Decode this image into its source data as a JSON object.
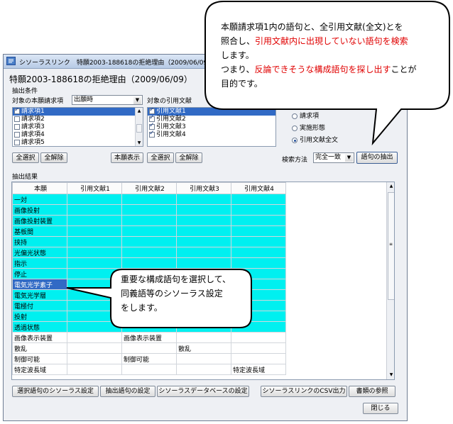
{
  "window": {
    "title": "シソーラスリンク　特願2003-188618の拒絶理由（2009/06/09）",
    "heading": "特願2003-188618の拒絶理由（2009/06/09）"
  },
  "extract_conditions": {
    "group_label": "抽出条件",
    "claims_label": "対象の本願請求項",
    "claims_dropdown": "出願時",
    "claims": [
      {
        "label": "請求項1",
        "checked": true,
        "selected": true
      },
      {
        "label": "請求項2",
        "checked": false,
        "selected": false
      },
      {
        "label": "請求項3",
        "checked": false,
        "selected": false
      },
      {
        "label": "請求項4",
        "checked": false,
        "selected": false
      },
      {
        "label": "請求項5",
        "checked": false,
        "selected": false
      }
    ],
    "citations_label": "対象の引用文献",
    "citations": [
      {
        "label": "引用文献1",
        "checked": true,
        "selected": true
      },
      {
        "label": "引用文献2",
        "checked": true,
        "selected": false
      },
      {
        "label": "引用文献3",
        "checked": true,
        "selected": false
      },
      {
        "label": "引用文献4",
        "checked": true,
        "selected": false
      }
    ],
    "select_all": "全選択",
    "clear_all": "全解除",
    "show_application": "本願表示",
    "radios": [
      {
        "label": "請求項",
        "checked": false
      },
      {
        "label": "実施形態",
        "checked": false
      },
      {
        "label": "引用文献全文",
        "checked": true
      }
    ],
    "search_method_label": "検索方法",
    "search_method_value": "完全一致",
    "extract_button": "語句の抽出"
  },
  "results": {
    "group_label": "抽出結果",
    "headers": [
      "本願",
      "引用文献1",
      "引用文献2",
      "引用文献3",
      "引用文献4"
    ],
    "rows": [
      {
        "cells": [
          "一対",
          "",
          "",
          "",
          ""
        ],
        "style": "cyan"
      },
      {
        "cells": [
          "画像投射",
          "",
          "",
          "",
          ""
        ],
        "style": "cyan"
      },
      {
        "cells": [
          "画像投射装置",
          "",
          "",
          "",
          ""
        ],
        "style": "cyan"
      },
      {
        "cells": [
          "基板間",
          "",
          "",
          "",
          ""
        ],
        "style": "cyan"
      },
      {
        "cells": [
          "挟持",
          "",
          "",
          "",
          ""
        ],
        "style": "cyan"
      },
      {
        "cells": [
          "光偏光状態",
          "",
          "",
          "",
          ""
        ],
        "style": "cyan"
      },
      {
        "cells": [
          "指示",
          "",
          "",
          "",
          ""
        ],
        "style": "cyan"
      },
      {
        "cells": [
          "停止",
          "",
          "",
          "",
          ""
        ],
        "style": "cyan"
      },
      {
        "cells": [
          "電気光学素子",
          "",
          "",
          "",
          ""
        ],
        "style": "selected"
      },
      {
        "cells": [
          "電気光学層",
          "",
          "",
          "",
          ""
        ],
        "style": "cyan"
      },
      {
        "cells": [
          "電極付",
          "",
          "",
          "",
          ""
        ],
        "style": "cyan"
      },
      {
        "cells": [
          "投射",
          "",
          "",
          "",
          ""
        ],
        "style": "cyan"
      },
      {
        "cells": [
          "透過状態",
          "",
          "",
          "",
          ""
        ],
        "style": "cyan"
      },
      {
        "cells": [
          "画像表示装置",
          "",
          "画像表示装置",
          "",
          ""
        ],
        "style": "white"
      },
      {
        "cells": [
          "散乱",
          "",
          "",
          "散乱",
          ""
        ],
        "style": "white"
      },
      {
        "cells": [
          "制御可能",
          "",
          "制御可能",
          "",
          ""
        ],
        "style": "white"
      },
      {
        "cells": [
          "特定波長域",
          "",
          "",
          "",
          "特定波長域"
        ],
        "style": "white"
      }
    ]
  },
  "bottom_buttons": {
    "thesaurus_setting": "選択語句のシソーラス設定",
    "extract_setting": "抽出語句の設定",
    "thesaurus_db_setting": "シソーラスデータベースの設定",
    "csv_output": "シソーラスリンクのCSV出力",
    "reference": "書類の参照",
    "close": "閉じる"
  },
  "callout_top": {
    "line1": "本願請求項1内の語句と、全引用文献(全文)とを",
    "line2a": "照合し、",
    "line2b": "引用文献内に出現していない語句を検索",
    "line3": "します。",
    "line4a": "つまり、",
    "line4b": "反論できそうな構成語句を探し出す",
    "line4c": "ことが",
    "line5": "目的です。"
  },
  "callout_mid": {
    "line1": "重要な構成語句を選択して、",
    "line2": "同義語等のシソーラス設定",
    "line3": "をします。"
  },
  "colors": {
    "cyan": "#00f0f0",
    "selection": "#316ac5",
    "emphasis": "#e00000"
  }
}
